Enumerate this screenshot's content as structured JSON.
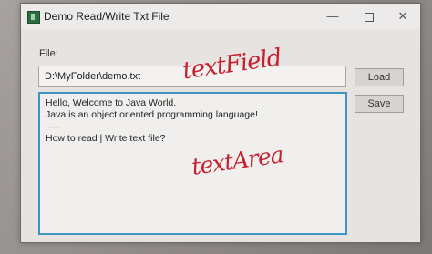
{
  "window": {
    "title": "Demo Read/Write Txt File",
    "icons": {
      "app": "java-app-icon",
      "minimize": "minimize-icon",
      "maximize": "maximize-icon",
      "close": "close-icon"
    }
  },
  "form": {
    "file_label": "File:",
    "file_path": "D:\\MyFolder\\demo.txt",
    "load_label": "Load",
    "save_label": "Save"
  },
  "text_area": {
    "lines": [
      "Hello, Welcome to Java World.",
      "Java is an object oriented programming language!",
      "------",
      "How to read | Write text file?"
    ],
    "focus_color": "#3d95c1"
  },
  "annotations": {
    "field_note": "textField",
    "area_note": "textArea",
    "ink_color": "#c4202e"
  }
}
